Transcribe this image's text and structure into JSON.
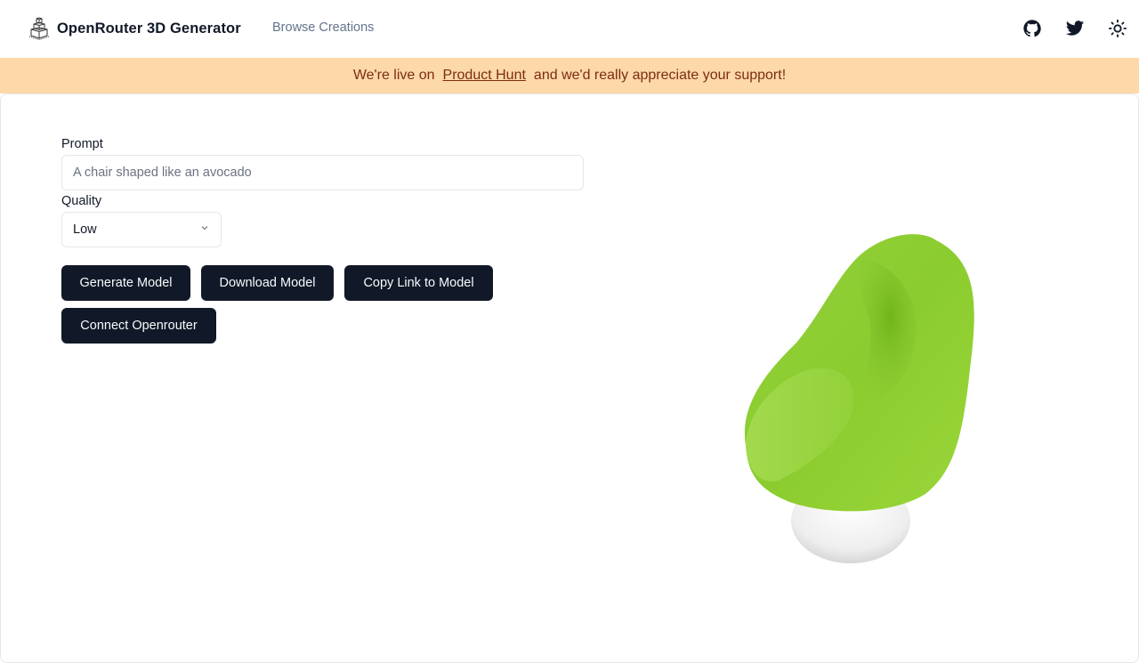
{
  "navbar": {
    "brand_icon": "cube-stack-icon",
    "title": "OpenRouter 3D Generator",
    "links": [
      {
        "label": "Browse Creations"
      }
    ],
    "icons": [
      "github-icon",
      "twitter-icon",
      "sun-icon"
    ]
  },
  "banner": {
    "prefix": "We're live on",
    "link_text": "Product Hunt",
    "suffix": "and we'd really appreciate your support!",
    "background": "#fdd8a8",
    "text_color": "#7c2d12"
  },
  "form": {
    "prompt_label": "Prompt",
    "prompt_value": "",
    "prompt_placeholder": "A chair shaped like an avocado",
    "quality_label": "Quality",
    "quality_selected": "Low"
  },
  "buttons": {
    "generate": "Generate Model",
    "download": "Download Model",
    "copy_link": "Copy Link to Model",
    "connect": "Connect Openrouter"
  },
  "viewer": {
    "model_description": "green avocado-shaped chair on white pedestal",
    "seat_color": "#8fd13a",
    "base_color": "#f0f0f0"
  },
  "theme": {
    "primary": "#111827",
    "muted": "#64748b"
  }
}
